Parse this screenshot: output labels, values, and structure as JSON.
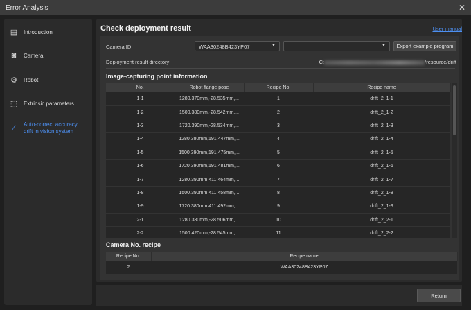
{
  "window": {
    "title": "Error Analysis",
    "close_icon": "close-icon"
  },
  "sidebar": {
    "items": [
      {
        "label": "Introduction",
        "icon": "document-icon",
        "active": false
      },
      {
        "label": "Camera",
        "icon": "camera-icon",
        "active": false
      },
      {
        "label": "Robot",
        "icon": "robot-arm-icon",
        "active": false
      },
      {
        "label": "Extrinsic parameters",
        "icon": "extrinsic-icon",
        "active": false
      },
      {
        "label": "Auto-correct accuracy drift in vision system",
        "line1": "Auto-correct accuracy",
        "line2": "drift in vision system",
        "icon": "drift-correct-icon",
        "active": true
      }
    ]
  },
  "main": {
    "title": "Check deployment result",
    "user_manual": "User manual",
    "camera_id_label": "Camera ID",
    "camera_id_value": "WAA30248B423YP07",
    "second_select_value": "",
    "export_button": "Export example program",
    "directory_label": "Deployment result directory",
    "directory_prefix": "C:",
    "directory_suffix": "/resource/drift",
    "points_title": "Image-capturing point information",
    "points_columns": [
      "No.",
      "Robot flange pose",
      "Recipe No.",
      "Recipe name"
    ],
    "points_rows": [
      [
        "1-1",
        "1280.370mm,-28.535mm,...",
        "1",
        "drift_2_1-1"
      ],
      [
        "1-2",
        "1500.380mm,-28.542mm,...",
        "2",
        "drift_2_1-2"
      ],
      [
        "1-3",
        "1720.390mm,-28.534mm,...",
        "3",
        "drift_2_1-3"
      ],
      [
        "1-4",
        "1280.380mm,191.447mm,...",
        "4",
        "drift_2_1-4"
      ],
      [
        "1-5",
        "1500.390mm,191.475mm,...",
        "5",
        "drift_2_1-5"
      ],
      [
        "1-6",
        "1720.390mm,191.481mm,...",
        "6",
        "drift_2_1-6"
      ],
      [
        "1-7",
        "1280.390mm,411.464mm,...",
        "7",
        "drift_2_1-7"
      ],
      [
        "1-8",
        "1500.390mm,411.458mm,...",
        "8",
        "drift_2_1-8"
      ],
      [
        "1-9",
        "1720.380mm,411.492mm,...",
        "9",
        "drift_2_1-9"
      ],
      [
        "2-1",
        "1280.380mm,-28.506mm,...",
        "10",
        "drift_2_2-1"
      ],
      [
        "2-2",
        "1500.420mm,-28.545mm,...",
        "11",
        "drift_2_2-2"
      ]
    ],
    "camera_recipe_title": "Camera No. recipe",
    "camera_recipe_columns": [
      "Recipe No.",
      "Recipe name"
    ],
    "camera_recipe_rows": [
      [
        "2",
        "WAA30248B423YP07"
      ]
    ]
  },
  "footer": {
    "return_button": "Return"
  }
}
